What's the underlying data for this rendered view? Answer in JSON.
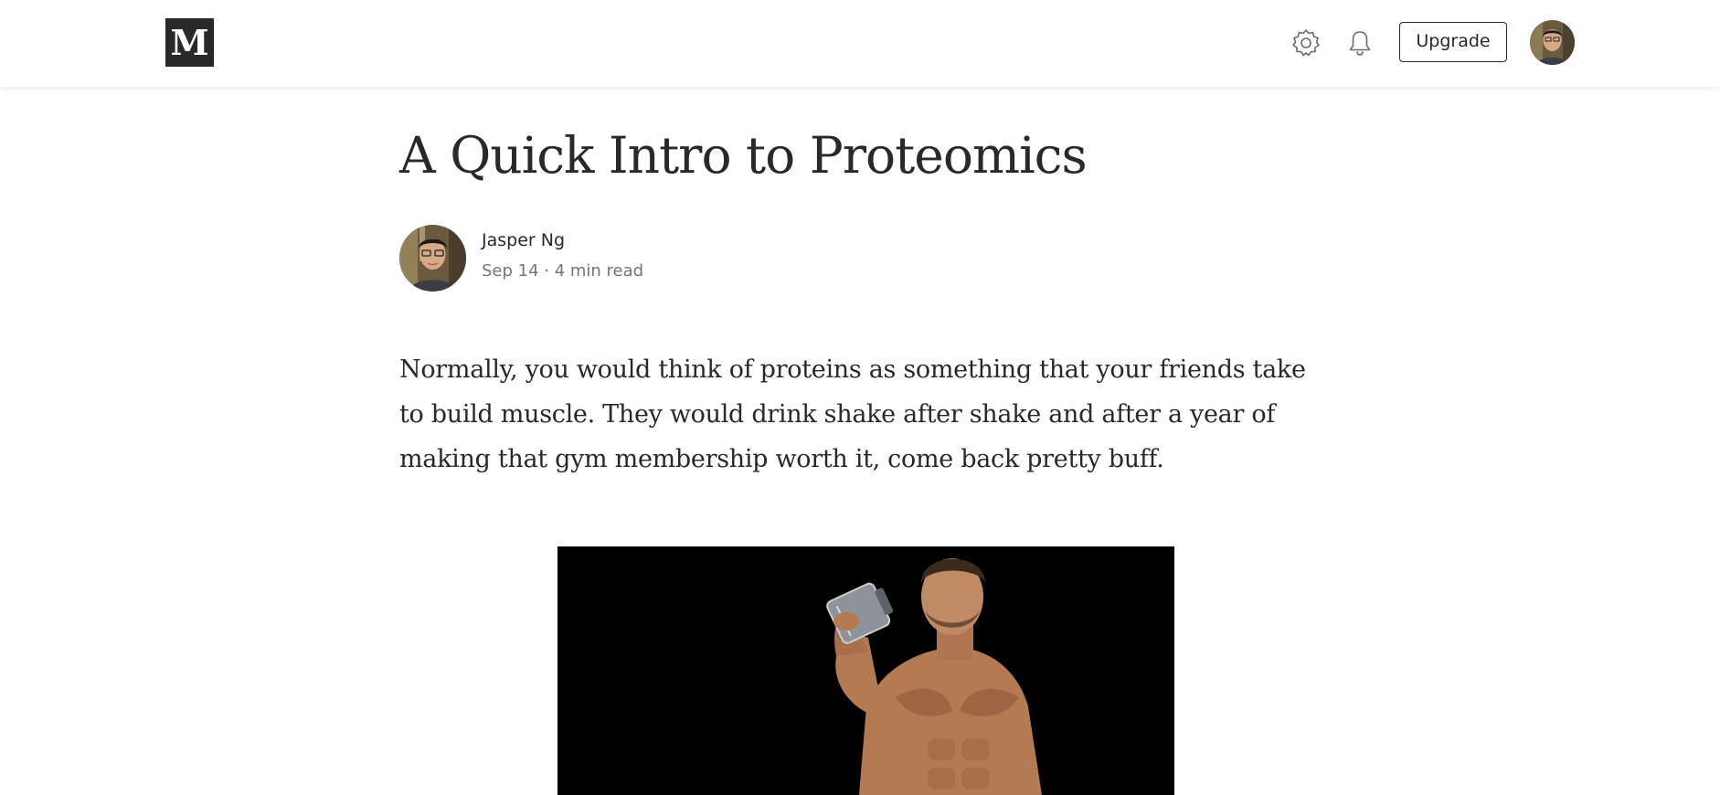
{
  "header": {
    "logo_text": "M",
    "settings_icon": "gear-icon",
    "notifications_icon": "bell-icon",
    "upgrade_label": "Upgrade",
    "avatar_icon": "user-avatar"
  },
  "article": {
    "title": "A Quick Intro to Proteomics",
    "author": "Jasper Ng",
    "meta": "Sep 14 · 4 min read",
    "paragraph": "Normally, you would think of proteins as something that your friends take to build muscle. They would drink shake after shake and after a year of making that gym membership worth it, come back pretty buff.",
    "hero_image": "man-drinking-shake-image"
  },
  "colors": {
    "text": "#292929",
    "muted": "#757575",
    "logo_bg": "#292929",
    "hero_bg": "#000000"
  }
}
